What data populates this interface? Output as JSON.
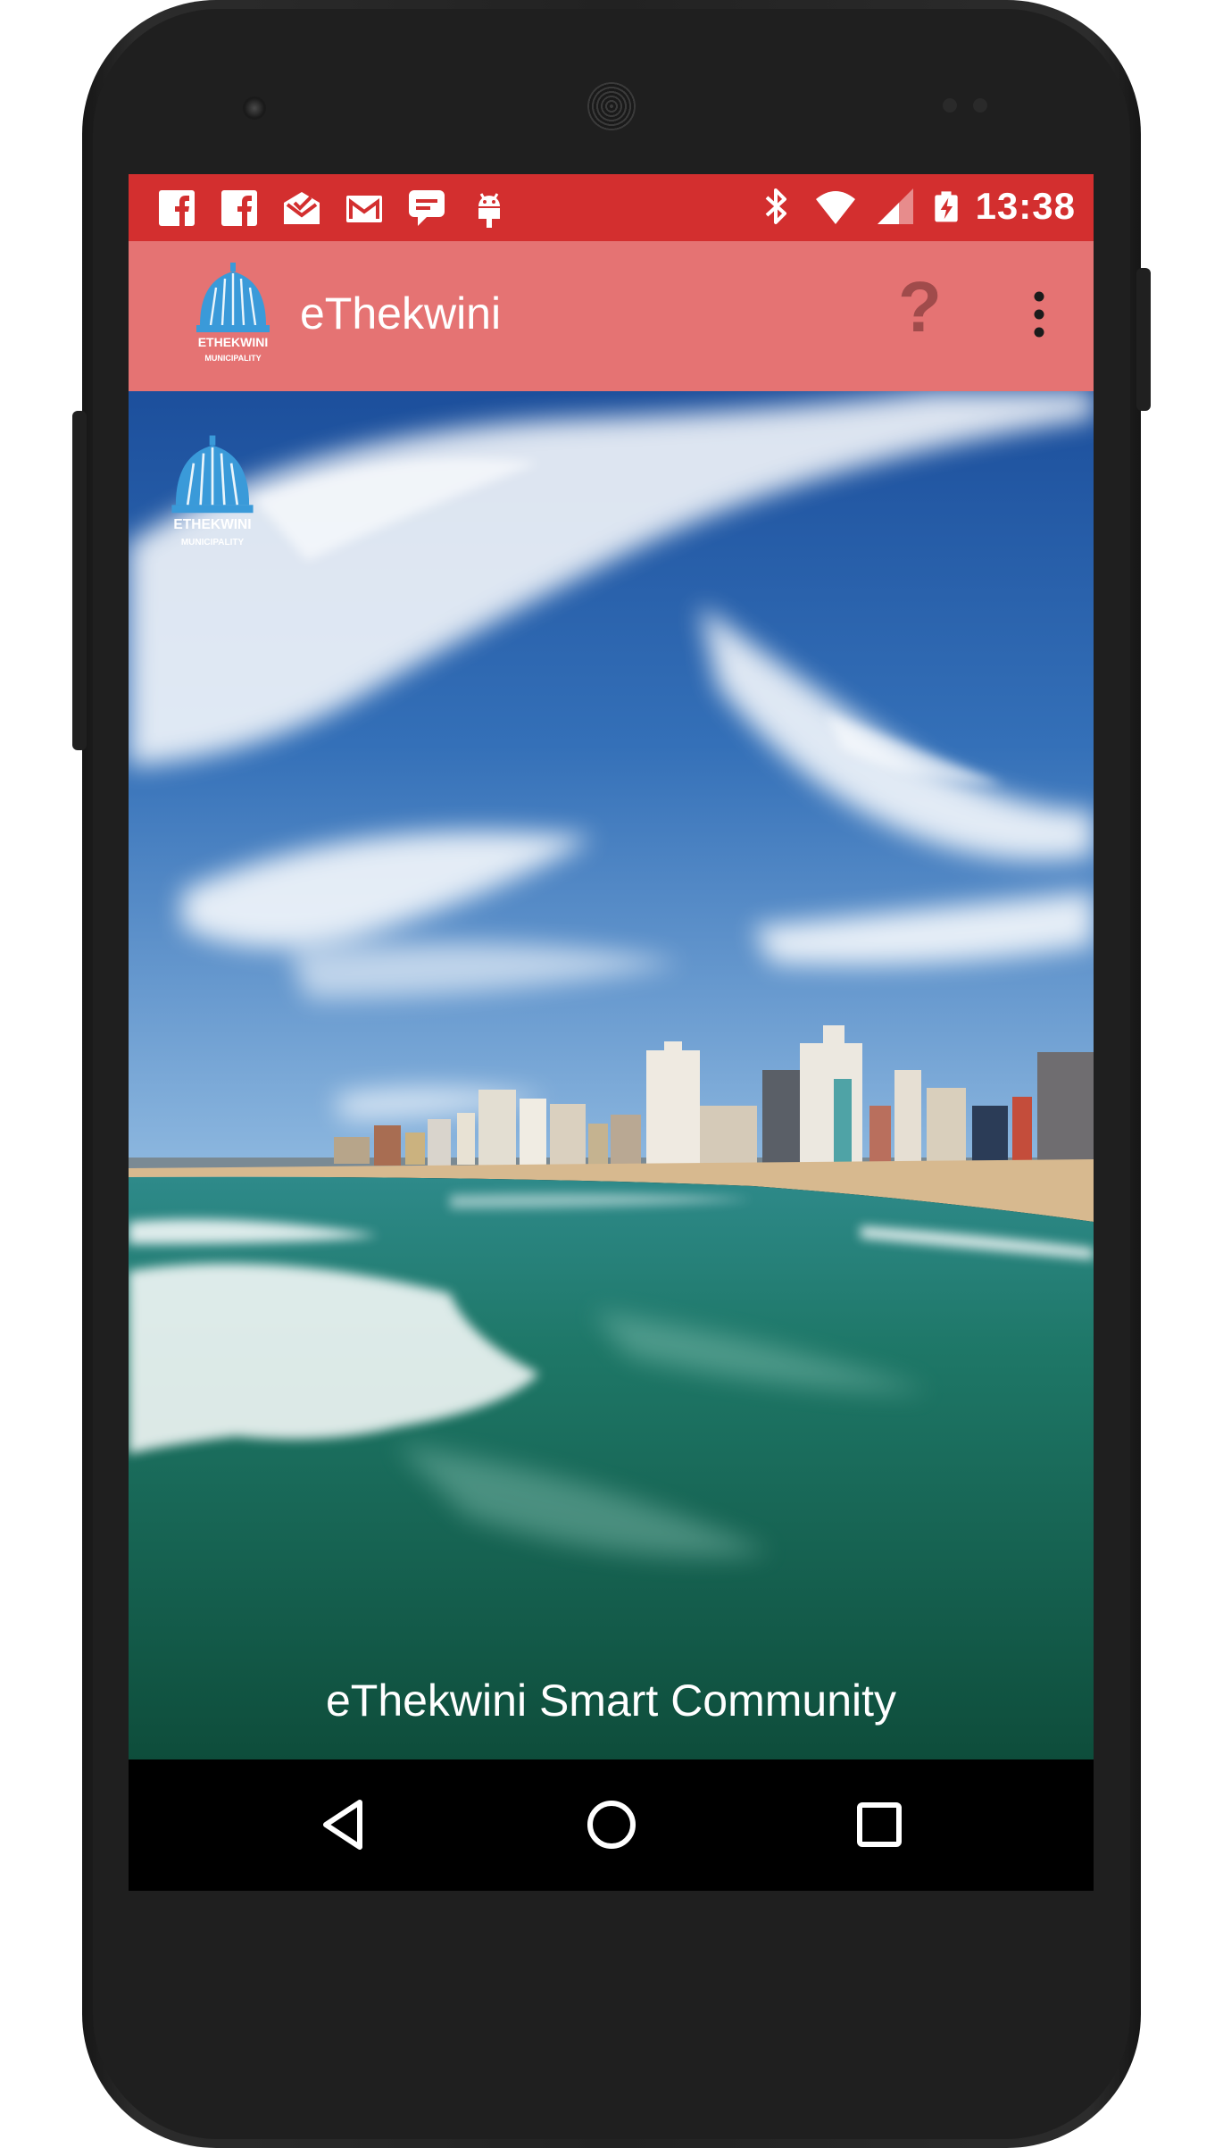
{
  "status_bar": {
    "notification_icons": [
      "facebook-icon",
      "facebook-icon",
      "email-icon",
      "gmail-icon",
      "chat-icon",
      "android-icon"
    ],
    "system_icons": [
      "bluetooth-icon",
      "wifi-icon",
      "signal-icon",
      "battery-charging-icon"
    ],
    "time": "13:38",
    "color": "#d32f2f"
  },
  "app_bar": {
    "title": "eThekwini",
    "help_label": "?",
    "color": "#e57373"
  },
  "logo": {
    "line1": "ETHEKWINI",
    "line2": "MUNICIPALITY"
  },
  "hero": {
    "caption": "eThekwini Smart Community"
  },
  "nav_bar": {
    "buttons": [
      "back-icon",
      "home-icon",
      "recents-icon"
    ]
  }
}
